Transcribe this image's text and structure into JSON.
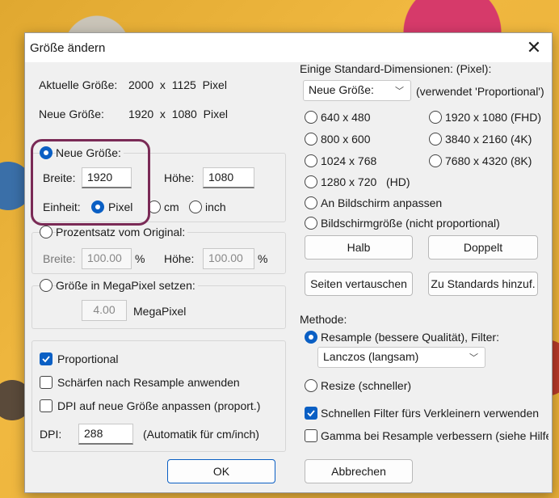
{
  "dialog": {
    "title": "Größe ändern",
    "current_label": "Aktuelle Größe:",
    "current_value": "2000  x  1125  Pixel",
    "new_label": "Neue Größe:",
    "new_value": "1920  x  1080  Pixel"
  },
  "size_group": {
    "label": "Neue Größe:",
    "width_label": "Breite:",
    "width_value": "1920",
    "height_label": "Höhe:",
    "height_value": "1080",
    "unit_label": "Einheit:",
    "unit_pixel": "Pixel",
    "unit_cm": "cm",
    "unit_inch": "inch"
  },
  "percent_group": {
    "label": "Prozentsatz vom Original:",
    "width_label": "Breite:",
    "width_value": "100.00",
    "width_unit": "%",
    "height_label": "Höhe:",
    "height_value": "100.00",
    "height_unit": "%"
  },
  "megapixel_group": {
    "label": "Größe in MegaPixel setzen:",
    "value": "4.00",
    "unit": "MegaPixel"
  },
  "options": {
    "proportional": "Proportional",
    "sharpen": "Schärfen nach Resample anwenden",
    "dpi_adjust": "DPI auf neue Größe anpassen (proport.)",
    "dpi_label": "DPI:",
    "dpi_value": "288",
    "dpi_note": "(Automatik für cm/inch)"
  },
  "standard": {
    "label": "Einige Standard-Dimensionen: (Pixel):",
    "select_value": "Neue Größe:",
    "select_note": "(verwendet 'Proportional')",
    "r640": "640 x 480",
    "r1920": "1920 x 1080 (FHD)",
    "r800": "800 x 600",
    "r3840": "3840 x 2160 (4K)",
    "r1024": "1024 x 768",
    "r7680": "7680 x 4320 (8K)",
    "r1280": "1280 x 720   (HD)",
    "fit_screen": "An Bildschirm anpassen",
    "screen_size": "Bildschirmgröße (nicht proportional)",
    "half": "Halb",
    "double": "Doppelt",
    "swap": "Seiten vertauschen",
    "add_std": "Zu Standards hinzuf."
  },
  "method": {
    "label": "Methode:",
    "resample": "Resample (bessere Qualität), Filter:",
    "filter_value": "Lanczos (langsam)",
    "resize": "Resize (schneller)",
    "fast_filter": "Schnellen Filter fürs Verkleinern verwenden",
    "gamma": "Gamma bei Resample verbessern (siehe Hilfe"
  },
  "buttons": {
    "ok": "OK",
    "cancel": "Abbrechen"
  },
  "colors": {
    "accent": "#0a5fc4",
    "highlight": "#7a2a56"
  }
}
